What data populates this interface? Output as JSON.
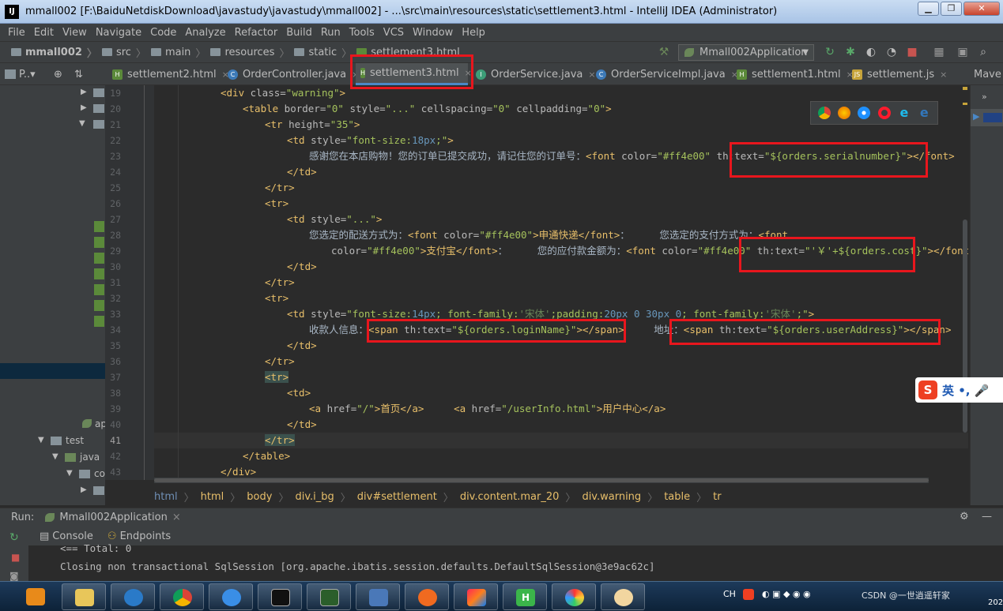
{
  "window": {
    "title": "mmall002 [F:\\BaiduNetdiskDownload\\javastudy\\javastudy\\mmall002] - ...\\src\\main\\resources\\static\\settlement3.html - IntelliJ IDEA (Administrator)",
    "app_icon": "IJ"
  },
  "menu": [
    "File",
    "Edit",
    "View",
    "Navigate",
    "Code",
    "Analyze",
    "Refactor",
    "Build",
    "Run",
    "Tools",
    "VCS",
    "Window",
    "Help"
  ],
  "breadcrumb": [
    "mmall002",
    "src",
    "main",
    "resources",
    "static",
    "settlement3.html"
  ],
  "run_config": "Mmall002Application",
  "tabs": [
    {
      "label": "settlement2.html",
      "icon": "html-file-icon"
    },
    {
      "label": "OrderController.java",
      "icon": "java-class-icon"
    },
    {
      "label": "settlement3.html",
      "icon": "html-file-icon",
      "active": true
    },
    {
      "label": "OrderService.java",
      "icon": "java-class-icon"
    },
    {
      "label": "OrderServiceImpl.java",
      "icon": "java-class-icon"
    },
    {
      "label": "settlement1.html",
      "icon": "html-file-icon"
    },
    {
      "label": "settlement.js",
      "icon": "js-file-icon"
    }
  ],
  "project_tab_label": "P..▾",
  "maven_tab_label": "Mave",
  "project_tree": {
    "ap_label": "ap",
    "test_label": "test",
    "java_label": "java",
    "co_label": "co"
  },
  "line_numbers": [
    "19",
    "20",
    "21",
    "22",
    "23",
    "24",
    "25",
    "26",
    "27",
    "28",
    "29",
    "30",
    "31",
    "32",
    "33",
    "34",
    "35",
    "36",
    "37",
    "38",
    "39",
    "40",
    "41",
    "42",
    "43"
  ],
  "code": {
    "l19": [
      "<div",
      " class=",
      "\"warning\"",
      ">"
    ],
    "l20": [
      "<table",
      " border=",
      "\"0\"",
      " style=",
      "\"...\"",
      " cellspacing=",
      "\"0\"",
      " cellpadding=",
      "\"0\"",
      ">"
    ],
    "l21": [
      "<tr",
      " height=",
      "\"35\"",
      ">"
    ],
    "l22": [
      "<td",
      " style=",
      "\"font-size:",
      "18px",
      ";\"",
      ">"
    ],
    "l23": [
      "感谢您在本店购物！您的订单已提交成功，请记住您的订单号：",
      "<font",
      " color=",
      "\"#ff4e00\"",
      " th:text=",
      "\"${orders.serialnumber}\"",
      "></font>"
    ],
    "l24": [
      "</td>"
    ],
    "l25": [
      "</tr>"
    ],
    "l26": [
      "<tr>"
    ],
    "l27": [
      "<td",
      " style=",
      "\"...\"",
      ">"
    ],
    "l28": [
      "您选定的配送方式为：",
      "<font",
      " color=",
      "\"#ff4e00\"",
      ">申通快递</font>",
      "：     您选定的支付方式为：",
      "<font"
    ],
    "l29": [
      "color=",
      "\"#ff4e00\"",
      ">支付宝</font>",
      "：     您的应付款金额为：",
      "<font",
      " color=",
      "\"#ff4e00\"",
      " th:text=",
      "\"'￥'+${orders.cost}\"",
      "></font>"
    ],
    "l30": [
      "</td>"
    ],
    "l31": [
      "</tr>"
    ],
    "l32": [
      "<tr>"
    ],
    "l33": [
      "<td",
      " style=",
      "\"font-size:",
      "14px",
      "; font-family:",
      "'宋体'",
      ";padding:",
      "20px 0 30px 0",
      "; font-family:",
      "'宋体'",
      ";\"",
      ">"
    ],
    "l34": [
      "收款人信息：",
      "<span",
      " th:text=",
      "\"${orders.loginName}\"",
      "></span>",
      "     地址：",
      "<span",
      " th:text=",
      "\"${orders.userAddress}\"",
      "></span>"
    ],
    "l35": [
      "</td>"
    ],
    "l36": [
      "</tr>"
    ],
    "l37": [
      "<tr>"
    ],
    "l38": [
      "<td>"
    ],
    "l39": [
      "<a",
      " href=",
      "\"/\"",
      ">首页</a>",
      "     ",
      "<a",
      " href=",
      "\"/userInfo.html\"",
      ">用户中心</a>"
    ],
    "l40": [
      "</td>"
    ],
    "l41": [
      "</tr>"
    ],
    "l42": [
      "</table>"
    ],
    "l43": [
      "</div>"
    ]
  },
  "structure_path": [
    "html",
    "html",
    "body",
    "div.i_bg",
    "div#settlement",
    "div.content.mar_20",
    "div.warning",
    "table",
    "tr"
  ],
  "run_panel": {
    "label": "Run:",
    "config": "Mmall002Application",
    "tabs": [
      "Console",
      "Endpoints"
    ],
    "console_lines": [
      "<==      Total: 0",
      "Closing non transactional SqlSession [org.apache.ibatis.session.defaults.DefaultSqlSession@3e9ac62c]"
    ]
  },
  "ime": {
    "logo": "S",
    "text": "英 •, 🎤"
  },
  "tray": {
    "text": "CH",
    "watermark": "CSDN @一世逍遥轩家",
    "year_partial": "202"
  },
  "colors": {
    "accent_red": "#e8161d",
    "tag": "#e8bf6a",
    "attr_value": "#a5c25c",
    "number": "#6897bb"
  }
}
